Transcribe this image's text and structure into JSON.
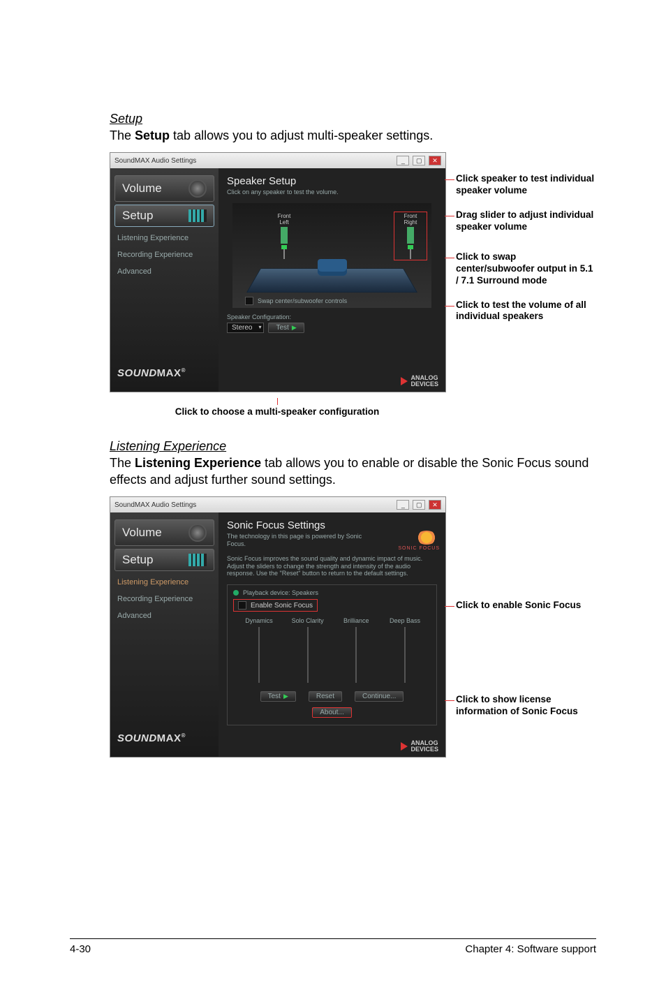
{
  "sections": {
    "setup": {
      "title": "Setup",
      "desc_pre": "The ",
      "desc_bold": "Setup",
      "desc_post": " tab allows you to adjust multi-speaker settings."
    },
    "listen": {
      "title": "Listening Experience",
      "desc_pre": "The ",
      "desc_bold": "Listening Experience",
      "desc_post": " tab allows you to enable or disable the Sonic Focus sound effects and adjust further sound settings."
    }
  },
  "window": {
    "title": "SoundMAX Audio Settings",
    "sidebar": {
      "volume": "Volume",
      "setup": "Setup",
      "listening": "Listening Experience",
      "recording": "Recording Experience",
      "advanced": "Advanced"
    },
    "logo_a": "SOUND",
    "logo_b": "MAX",
    "footer_brand": "ANALOG\nDEVICES"
  },
  "setup_panel": {
    "title": "Speaker Setup",
    "sub": "Click on any speaker to test the volume.",
    "spk_left": "Front\nLeft",
    "spk_right": "Front\nRight",
    "swap": "Swap center/subwoofer controls",
    "config_label": "Speaker Configuration:",
    "dd_value": "Stereo",
    "test": "Test"
  },
  "setup_callouts": {
    "c1": "Click speaker to test individual speaker volume",
    "c2": "Drag slider to adjust individual speaker volume",
    "c3": "Click to swap center/subwoofer output in 5.1 / 7.1 Surround mode",
    "c4": "Click to test the volume of all individual speakers",
    "caption": "Click to choose a multi-speaker configuration"
  },
  "listen_panel": {
    "title": "Sonic Focus Settings",
    "sub1": "The technology in this page is powered by Sonic Focus.",
    "sub2": "Sonic Focus improves the sound quality and dynamic impact of music. Adjust the sliders to change the strength and intensity of the audio response. Use the \"Reset\" button to return to the default settings.",
    "brand": "SONIC FOCUS",
    "device": "Playback device: Speakers",
    "enable": "Enable Sonic Focus",
    "sliders": {
      "a": "Dynamics",
      "b": "Solo Clarity",
      "c": "Brilliance",
      "d": "Deep Bass"
    },
    "btn_test": "Test",
    "btn_reset": "Reset",
    "btn_cont": "Continue...",
    "btn_about": "About..."
  },
  "listen_callouts": {
    "c1": "Click to enable Sonic Focus",
    "c2": "Click to show license information of Sonic Focus"
  },
  "footer": {
    "left": "4-30",
    "right": "Chapter 4: Software support"
  }
}
